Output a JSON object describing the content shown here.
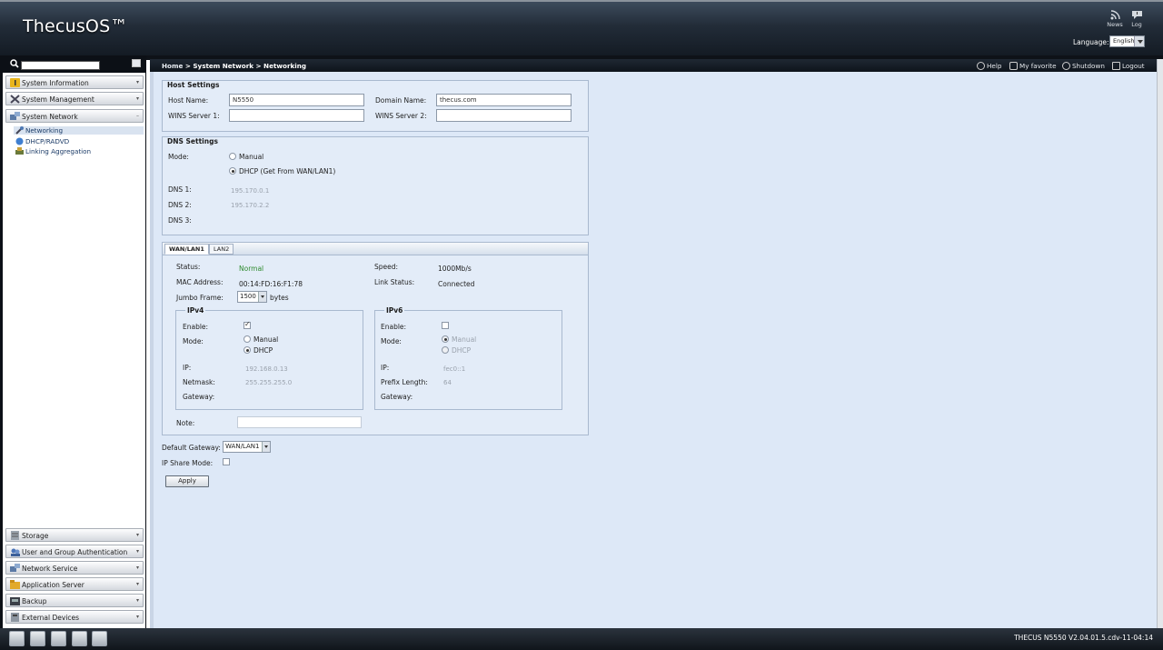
{
  "header": {
    "logo": "ThecusOS™",
    "news_label": "News",
    "log_label": "Log",
    "language_label": "Language:",
    "language_value": "English"
  },
  "sidebar": {
    "categories_top": [
      {
        "label": "System Information",
        "icon": "info-icon"
      },
      {
        "label": "System Management",
        "icon": "tools-icon"
      },
      {
        "label": "System Network",
        "icon": "network-icon"
      }
    ],
    "network_items": [
      {
        "label": "Networking",
        "icon": "networking-icon"
      },
      {
        "label": "DHCP/RADVD",
        "icon": "dhcp-icon"
      },
      {
        "label": "Linking Aggregation",
        "icon": "link-aggregation-icon"
      }
    ],
    "categories_bottom": [
      {
        "label": "Storage",
        "icon": "storage-icon"
      },
      {
        "label": "User and Group Authentication",
        "icon": "users-icon"
      },
      {
        "label": "Network Service",
        "icon": "network-service-icon"
      },
      {
        "label": "Application Server",
        "icon": "application-icon"
      },
      {
        "label": "Backup",
        "icon": "backup-icon"
      },
      {
        "label": "External Devices",
        "icon": "external-devices-icon"
      }
    ]
  },
  "breadcrumb": {
    "home": "Home",
    "rest": " > System Network > Networking"
  },
  "toolbar": {
    "help": "Help",
    "favorite": "My favorite",
    "shutdown": "Shutdown",
    "logout": "Logout"
  },
  "host": {
    "legend": "Host Settings",
    "host_name_label": "Host Name:",
    "host_name_value": "N5550",
    "domain_label": "Domain Name:",
    "domain_value": "thecus.com",
    "wins1_label": "WINS Server 1:",
    "wins1_value": "",
    "wins2_label": "WINS Server 2:",
    "wins2_value": ""
  },
  "dns": {
    "legend": "DNS Settings",
    "mode_label": "Mode:",
    "manual_label": "Manual",
    "dhcp_label": "DHCP (Get From WAN/LAN1)",
    "selected_mode": "DHCP",
    "dns1_label": "DNS 1:",
    "dns1_value": "195.170.0.1",
    "dns2_label": "DNS 2:",
    "dns2_value": "195.170.2.2",
    "dns3_label": "DNS 3:",
    "dns3_value": ""
  },
  "tabs": [
    {
      "label": "WAN/LAN1",
      "active": true
    },
    {
      "label": "LAN2",
      "active": false
    }
  ],
  "wan": {
    "status_label": "Status:",
    "status_value": "Normal",
    "status_color": "#2e8b2e",
    "speed_label": "Speed:",
    "speed_value": "1000Mb/s",
    "mac_label": "MAC Address:",
    "mac_value": "00:14:FD:16:F1:78",
    "link_label": "Link Status:",
    "link_value": "Connected",
    "jumbo_label": "Jumbo Frame:",
    "jumbo_value": "1500",
    "jumbo_unit": "bytes",
    "note_label": "Note:",
    "note_value": ""
  },
  "ipv4": {
    "legend": "IPv4",
    "enable_label": "Enable:",
    "enabled": true,
    "mode_label": "Mode:",
    "manual_label": "Manual",
    "dhcp_label": "DHCP",
    "selected_mode": "DHCP",
    "ip_label": "IP:",
    "ip_value": "192.168.0.13",
    "netmask_label": "Netmask:",
    "netmask_value": "255.255.255.0",
    "gateway_label": "Gateway:",
    "gateway_value": ""
  },
  "ipv6": {
    "legend": "IPv6",
    "enable_label": "Enable:",
    "enabled": false,
    "mode_label": "Mode:",
    "manual_label": "Manual",
    "dhcp_label": "DHCP",
    "selected_mode": "Manual",
    "ip_label": "IP:",
    "ip_value": "fec0::1",
    "prefix_label": "Prefix Length:",
    "prefix_value": "64",
    "gateway_label": "Gateway:",
    "gateway_value": ""
  },
  "bottom": {
    "default_gateway_label": "Default Gateway:",
    "default_gateway_value": "WAN/LAN1",
    "ip_share_label": "IP Share Mode:",
    "ip_share_checked": false,
    "apply_label": "Apply"
  },
  "footer": {
    "icons": [
      "disk-icon",
      "home-icon",
      "fan-icon",
      "info-icon",
      "network-topology-icon"
    ],
    "version": "THECUS N5550 V2.04.01.5.cdv-11-04:14"
  }
}
